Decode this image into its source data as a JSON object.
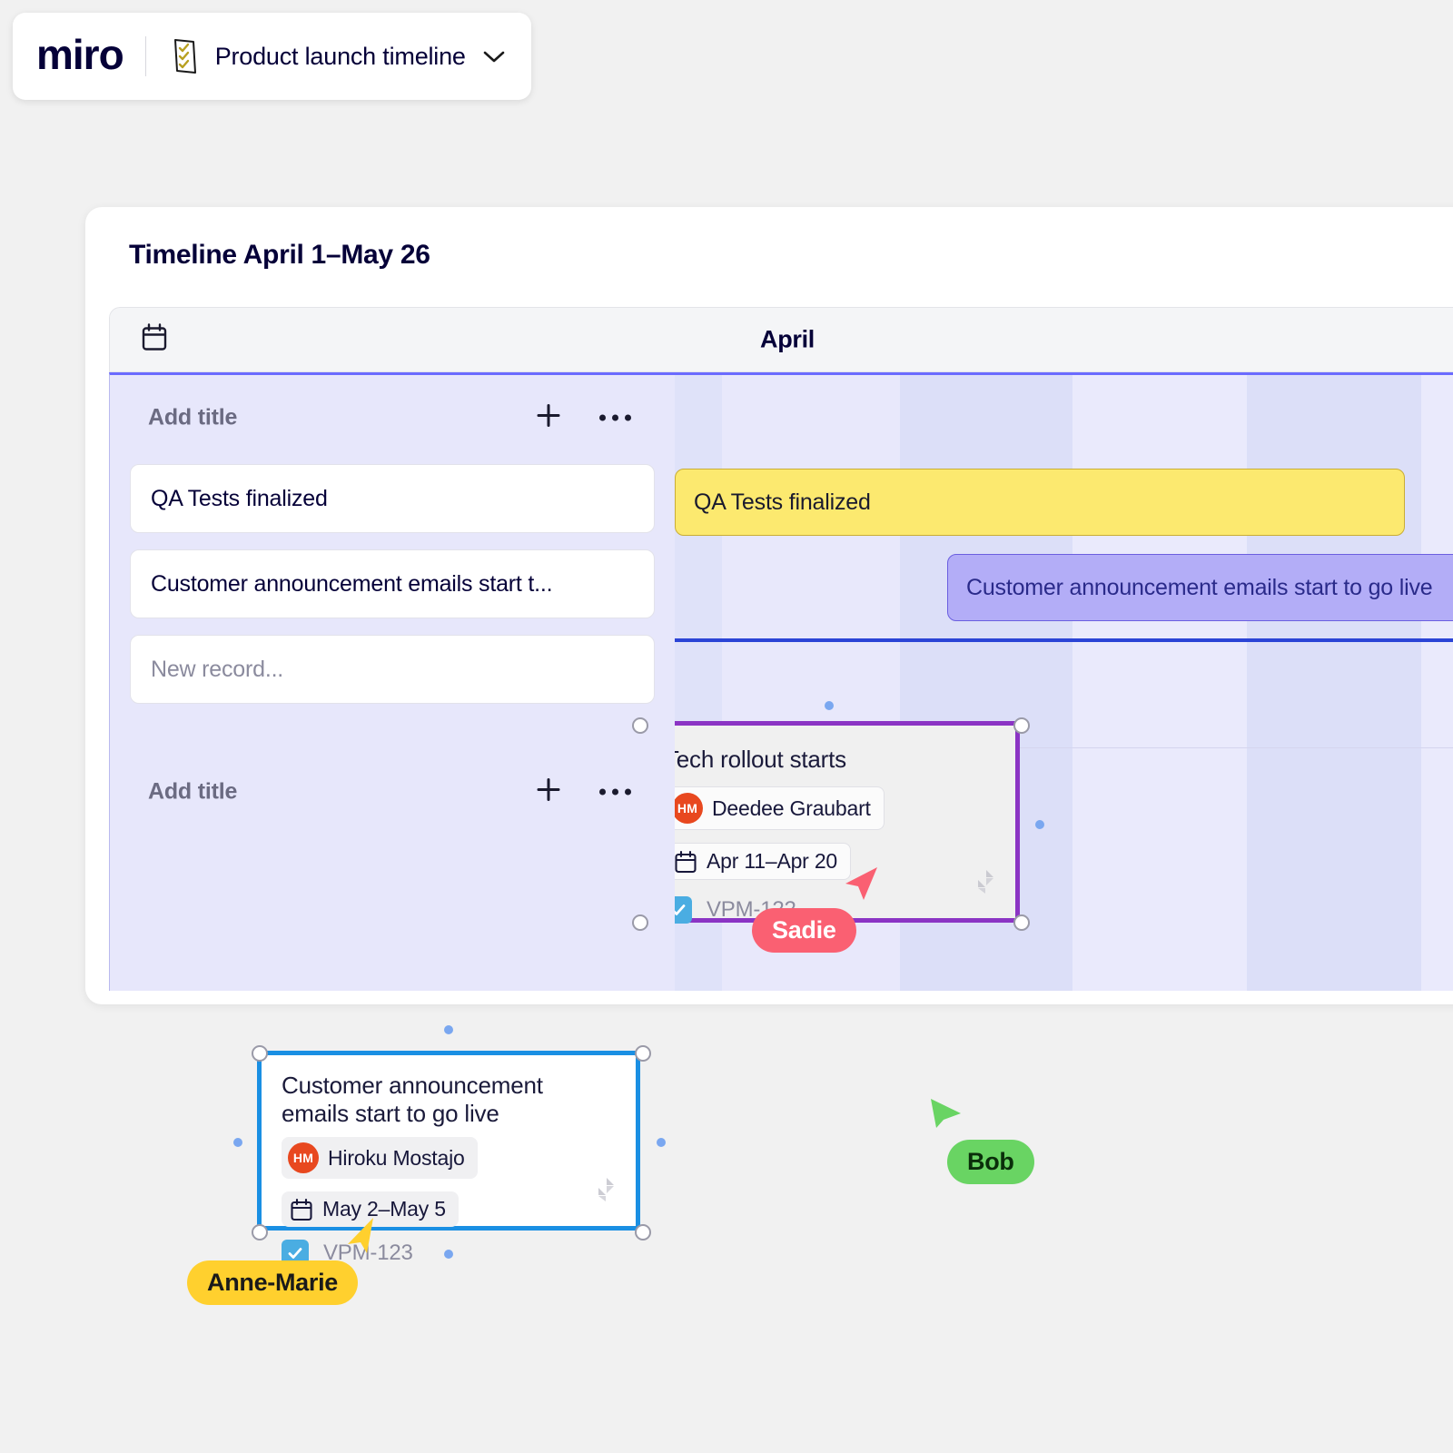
{
  "appbar": {
    "logo": "miro",
    "doc_icon": "checklist-icon",
    "doc_title": "Product launch timeline",
    "chevron": "chevron-down-icon"
  },
  "panel": {
    "title": "Timeline April 1–May 26",
    "header": {
      "calendar_icon": "calendar-icon",
      "month": "April"
    },
    "lanes": [
      {
        "title": "Add title",
        "add_label": "+",
        "more_label": "•••",
        "records": [
          {
            "text": "QA Tests finalized",
            "placeholder": false
          },
          {
            "text": "Customer announcement emails start t...",
            "placeholder": false
          },
          {
            "text": "New record...",
            "placeholder": true
          }
        ]
      },
      {
        "title": "Add title",
        "add_label": "+",
        "more_label": "•••",
        "records": []
      }
    ],
    "bars": [
      {
        "label": "QA Tests finalized",
        "color": "#fce96f",
        "border": "#c9ad35"
      },
      {
        "label": "Customer announcement emails start to go live",
        "color": "#b3adf7",
        "border": "#6b5fe0"
      }
    ]
  },
  "cards": [
    {
      "title": "Tech rollout starts",
      "assignee": "Deedee Graubart",
      "assignee_initials": "HM",
      "date_range": "Apr 11–Apr 20",
      "ticket": "VPM-122",
      "calendar_icon": "calendar-icon",
      "jira_icon": "jira-icon",
      "checkbox_icon": "checkbox-checked-icon",
      "border_color": "#8b34c4"
    },
    {
      "title": "Customer announcement emails start to go live",
      "assignee": "Hiroku Mostajo",
      "assignee_initials": "HM",
      "date_range": "May 2–May 5",
      "ticket": "VPM-123",
      "calendar_icon": "calendar-icon",
      "jira_icon": "jira-icon",
      "checkbox_icon": "checkbox-checked-icon",
      "border_color": "#1a8fe3"
    }
  ],
  "cursors": [
    {
      "name": "Sadie",
      "color": "#fa6072",
      "text_color": "#ffffff"
    },
    {
      "name": "Bob",
      "color": "#69d463",
      "text_color": "#0a2e0a"
    },
    {
      "name": "Anne-Marie",
      "color": "#ffd02e",
      "text_color": "#1a1a1a"
    }
  ]
}
